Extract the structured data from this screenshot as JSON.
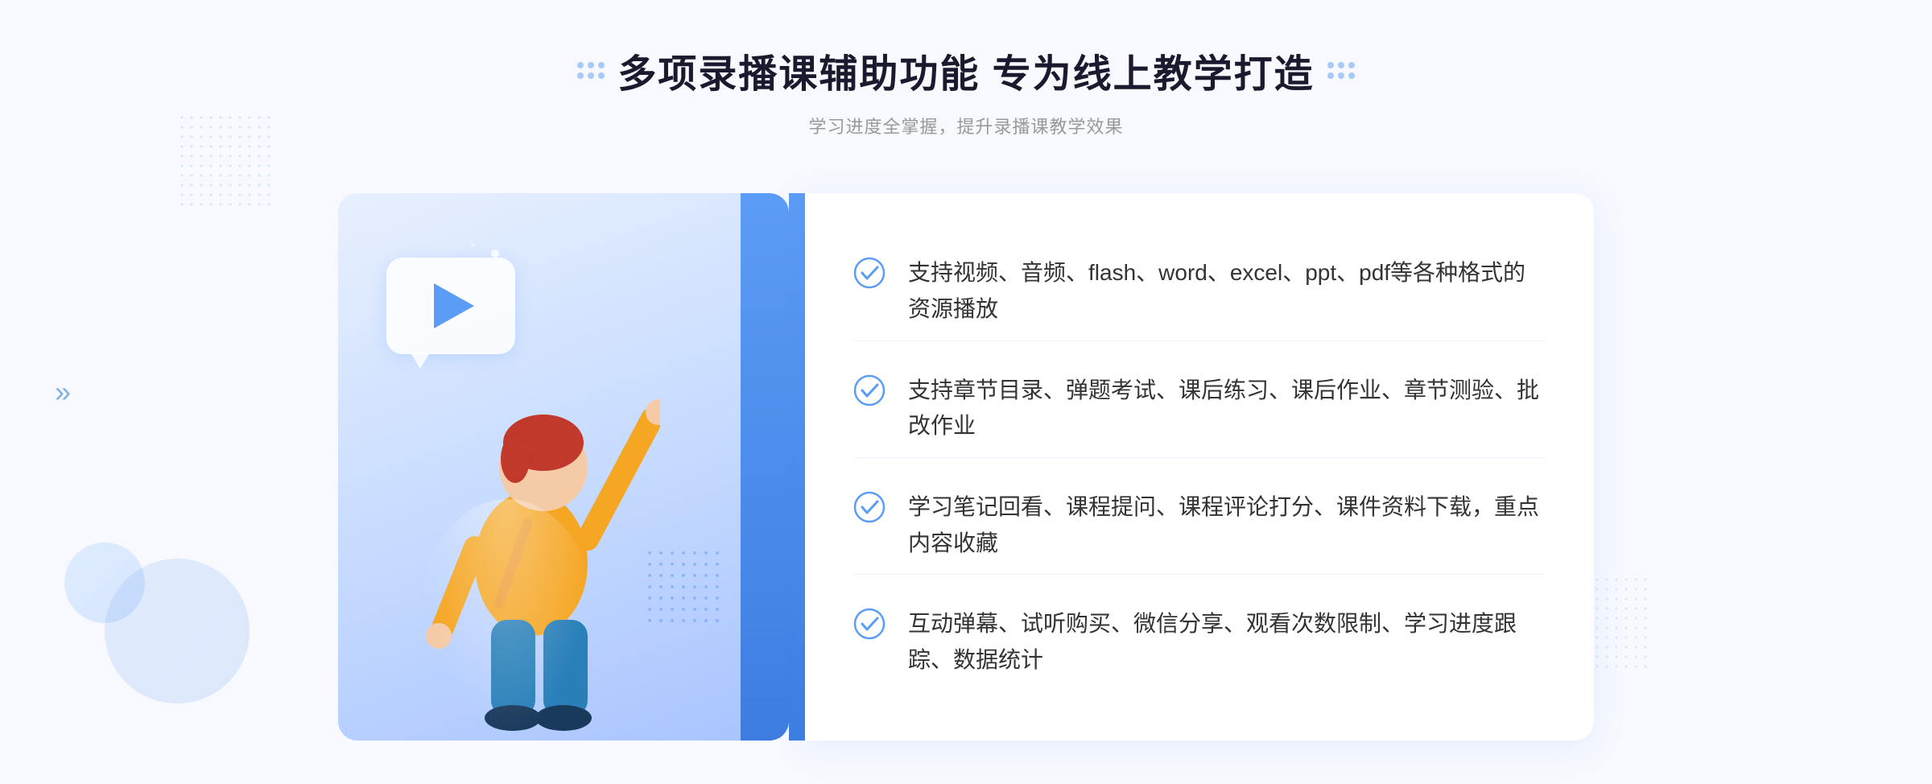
{
  "header": {
    "title": "多项录播课辅助功能 专为线上教学打造",
    "subtitle": "学习进度全掌握，提升录播课教学效果",
    "deco_dots_count": 6
  },
  "features": [
    {
      "id": 1,
      "text": "支持视频、音频、flash、word、excel、ppt、pdf等各种格式的资源播放"
    },
    {
      "id": 2,
      "text": "支持章节目录、弹题考试、课后练习、课后作业、章节测验、批改作业"
    },
    {
      "id": 3,
      "text": "学习笔记回看、课程提问、课程评论打分、课件资料下载，重点内容收藏"
    },
    {
      "id": 4,
      "text": "互动弹幕、试听购买、微信分享、观看次数限制、学习进度跟踪、数据统计"
    }
  ],
  "colors": {
    "primary": "#5b9cf6",
    "primary_dark": "#3d7de0",
    "text_dark": "#1a1a2e",
    "text_light": "#999999",
    "text_body": "#333333",
    "bg_light": "#f7f9ff",
    "bg_panel_left": "#dce9ff",
    "white": "#ffffff"
  },
  "icons": {
    "check": "✓",
    "play": "▶",
    "chevron_left": "«"
  }
}
